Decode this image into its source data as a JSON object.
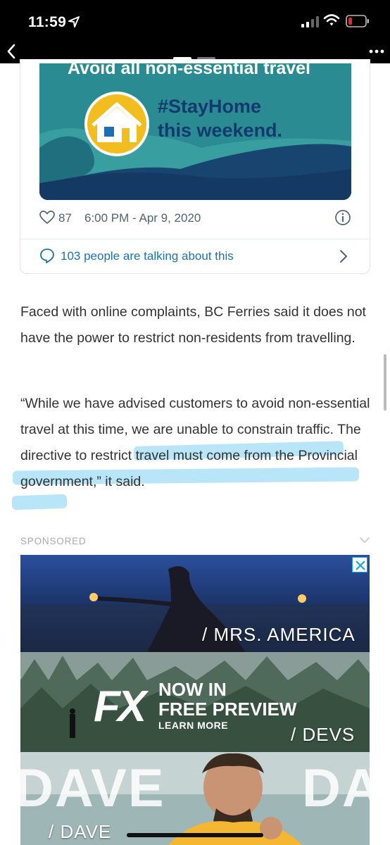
{
  "status_bar": {
    "time": "11:59"
  },
  "tweet": {
    "media": {
      "title": "Avoid all non-essential travel",
      "hashtag": "#StayHome",
      "subtitle": "this weekend."
    },
    "likes": "87",
    "timestamp": "6:00 PM - Apr 9, 2020",
    "talking": "103 people are talking about this"
  },
  "article": {
    "paragraph1": "Faced with online complaints, BC Ferries said it does not have the power to restrict non-residents from travelling.",
    "paragraph2": "“While we have advised customers to avoid non-essential travel at this time, we are unable to constrain traffic. The directive to restrict travel must come from the Provincial government,” it said."
  },
  "ad": {
    "label": "SPONSORED",
    "show1": "/ MRS. AMERICA",
    "fx_logo": "FX",
    "fx_line1": "NOW IN",
    "fx_line2": "FREE PREVIEW",
    "fx_line3": "LEARN MORE",
    "show2": "/ DEVS",
    "dave_big": "DAVE",
    "dave_big_right": "DA",
    "show3": "/ DAVE"
  },
  "colors": {
    "link": "#1b72b7",
    "highlight": "#7fd0f2",
    "media_teal": "#2a8b92",
    "media_navy": "#123a6e"
  }
}
